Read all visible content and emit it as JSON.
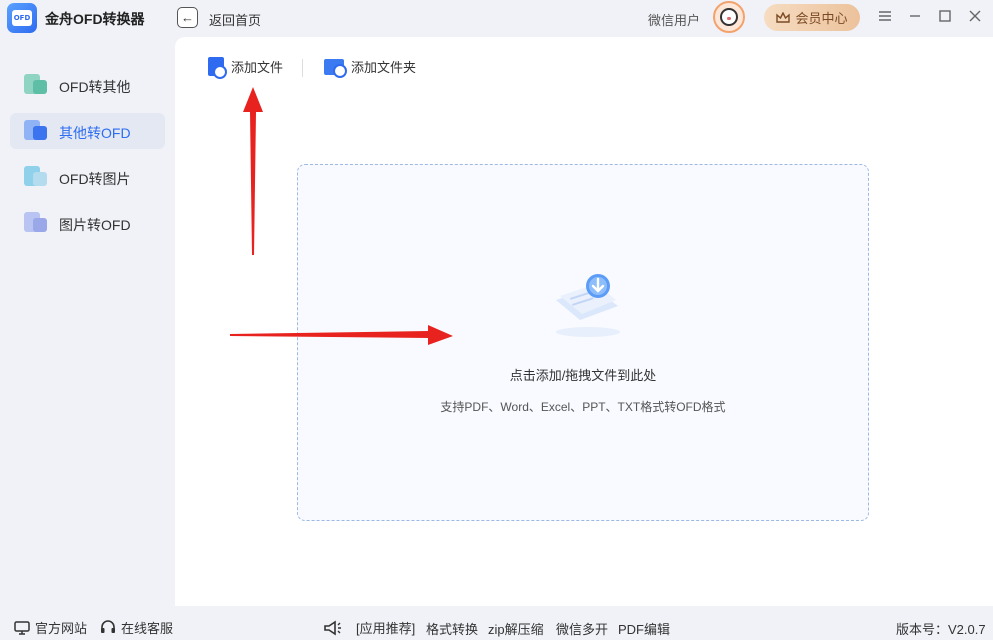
{
  "app": {
    "logo_text": "OFD",
    "title": "金舟OFD转换器"
  },
  "header": {
    "back_icon": "arrow-left-icon",
    "back_label": "返回首页",
    "user_name": "微信用户",
    "vip_label": "会员中心"
  },
  "sidebar": {
    "items": [
      {
        "label": "OFD转其他",
        "icon": "ofd-to-other-icon",
        "active": false
      },
      {
        "label": "其他转OFD",
        "icon": "other-to-ofd-icon",
        "active": true
      },
      {
        "label": "OFD转图片",
        "icon": "ofd-to-image-icon",
        "active": false
      },
      {
        "label": "图片转OFD",
        "icon": "image-to-ofd-icon",
        "active": false
      }
    ]
  },
  "toolbar": {
    "add_file": "添加文件",
    "add_folder": "添加文件夹"
  },
  "dropzone": {
    "title": "点击添加/拖拽文件到此处",
    "subtitle": "支持PDF、Word、Excel、PPT、TXT格式转OFD格式"
  },
  "footer": {
    "website": "官方网站",
    "support": "在线客服",
    "recommend": "[应用推荐]",
    "links": [
      "格式转换",
      "zip解压缩",
      "微信多开",
      "PDF编辑"
    ],
    "version": "版本号：V2.0.7"
  },
  "colors": {
    "accent": "#2d6df0",
    "annotation_arrow": "#e8231f"
  }
}
